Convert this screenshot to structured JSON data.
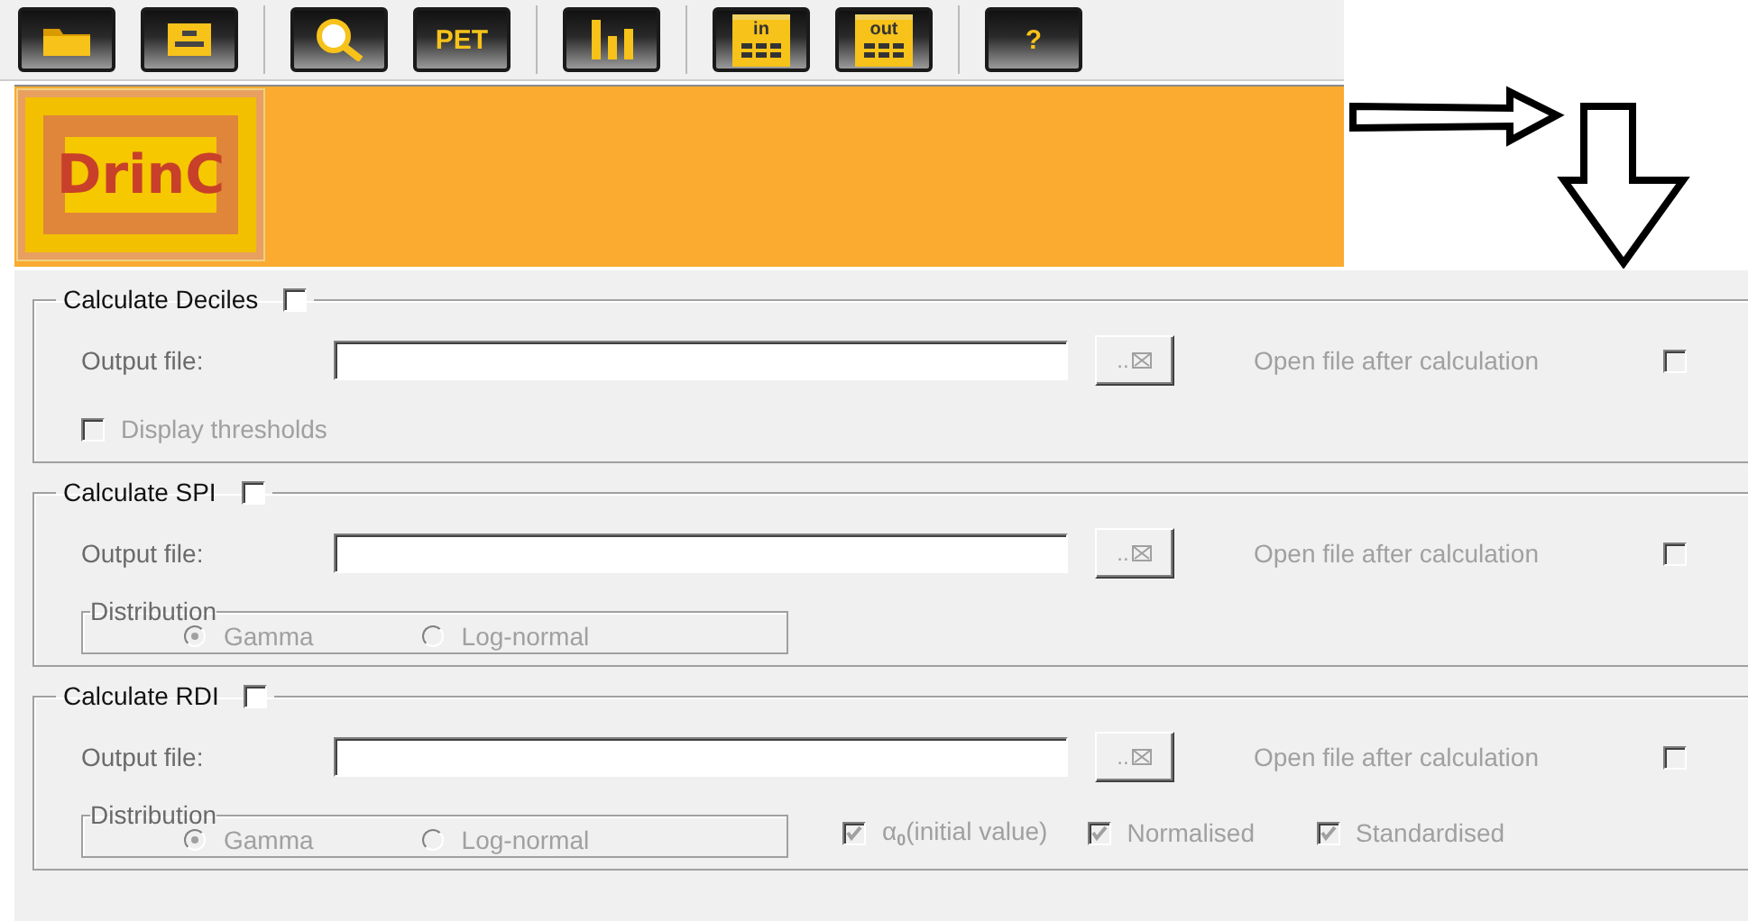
{
  "toolbar": {
    "groups": [
      [
        {
          "kind": "folder"
        },
        {
          "kind": "save"
        }
      ],
      [
        {
          "kind": "search"
        },
        {
          "kind": "text",
          "label": "PET"
        }
      ],
      [
        {
          "kind": "chart"
        }
      ],
      [
        {
          "kind": "table",
          "label": "in"
        },
        {
          "kind": "table",
          "label": "out"
        }
      ],
      [
        {
          "kind": "text",
          "label": "?"
        }
      ]
    ]
  },
  "banner": {
    "logo": "DrinC"
  },
  "sections": [
    {
      "title": "Calculate Deciles",
      "checked": false,
      "output_label": "Output file:",
      "browse_label": "..",
      "open_file": {
        "label": "Open file after calculation",
        "checked": false,
        "disabled": true
      },
      "options": [
        {
          "label": "Display thresholds",
          "checked": false,
          "disabled": true
        }
      ]
    },
    {
      "title": "Calculate SPI",
      "checked": false,
      "output_label": "Output file:",
      "browse_label": "..",
      "open_file": {
        "label": "Open file after calculation",
        "checked": false,
        "disabled": true
      },
      "distribution": {
        "legend": "Distribution",
        "disabled": true,
        "options": [
          {
            "label": "Gamma",
            "selected": true
          },
          {
            "label": "Log-normal",
            "selected": false
          }
        ]
      }
    },
    {
      "title": "Calculate RDI",
      "checked": false,
      "output_label": "Output file:",
      "browse_label": "..",
      "open_file": {
        "label": "Open file after calculation",
        "checked": false,
        "disabled": true
      },
      "distribution": {
        "legend": "Distribution",
        "disabled": true,
        "options": [
          {
            "label": "Gamma",
            "selected": true
          },
          {
            "label": "Log-normal",
            "selected": false
          }
        ]
      },
      "options": [
        {
          "label": "α$_{0}$(initial value)",
          "checked": true,
          "disabled": true
        },
        {
          "label": "Normalised",
          "checked": true,
          "disabled": true
        },
        {
          "label": "Standardised",
          "checked": true,
          "disabled": true
        }
      ]
    }
  ]
}
